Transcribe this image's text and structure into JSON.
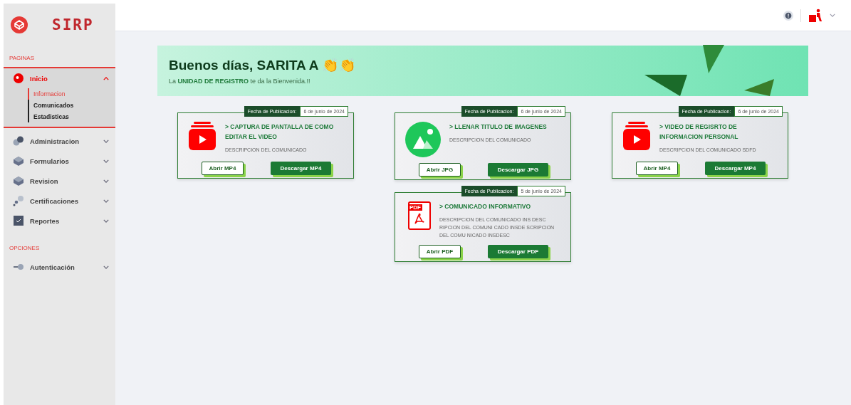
{
  "sidebar": {
    "brand": "SIRP",
    "sections": [
      {
        "title": "PAGINAS",
        "items": [
          {
            "label": "Inicio",
            "kind": "dot",
            "expanded": true,
            "selected": true,
            "children": [
              {
                "label": "Informacion",
                "selected": true
              },
              {
                "label": "Comunicados",
                "selected": false
              },
              {
                "label": "Estadisticas",
                "selected": false
              }
            ]
          },
          {
            "label": "Administracion",
            "kind": "blobs",
            "expanded": false,
            "selected": false
          },
          {
            "label": "Formularios",
            "kind": "cube",
            "expanded": false,
            "selected": false
          },
          {
            "label": "Revision",
            "kind": "cube",
            "expanded": false,
            "selected": false
          },
          {
            "label": "Certificaciones",
            "kind": "pin",
            "expanded": false,
            "selected": false
          },
          {
            "label": "Reportes",
            "kind": "check",
            "expanded": false,
            "selected": false
          }
        ]
      },
      {
        "title": "OPCIONES",
        "items": [
          {
            "label": "Autenticación",
            "kind": "login",
            "expanded": false,
            "selected": false
          }
        ]
      }
    ]
  },
  "banner": {
    "greeting": "Buenos días, SARITA A 👏👏",
    "subtitle": "La **UNIDAD DE REGISTRO** te da la Bienvenida.!!"
  },
  "cards": [
    {
      "kind": "video",
      "date_label": "Fecha de Publicacion:",
      "date": "6 de junio de 2024",
      "title": "> CAPTURA DE PANTALLA DE COMO EDITAR EL VIDEO",
      "description": "DESCRIPCION DEL COMUNICADO",
      "open": "Abrir MP4",
      "download": "Descargar MP4"
    },
    {
      "kind": "image",
      "date_label": "Fecha de Publicacion:",
      "date": "6 de junio de 2024",
      "title": "> LLENAR TITULO DE IMAGENES",
      "description": "DESCRIPCION DEL COMUNICADO",
      "open": "Abrir JPG",
      "download": "Descargar JPG"
    },
    {
      "kind": "video",
      "date_label": "Fecha de Publicacion:",
      "date": "6 de junio de 2024",
      "title": "> VIDEO DE REGISRTO DE INFORMACION PERSONAL",
      "description": "DESCRIPCION DEL COMUNICADO SDFD",
      "open": "Abrir MP4",
      "download": "Descargar MP4"
    },
    {
      "kind": "pdf",
      "icon_text": "PDF",
      "date_label": "Fecha de Publicacion:",
      "date": "5 de junio de 2024",
      "title": "> COMUNICADO INFORMATIVO",
      "description": "DESCRIPCION DEL COMUNICADO INS DESC RIPCION DEL COMUNI CADO INSDE SCRIPCION DEL COMU NICADO INSDESC",
      "open": "Abrir PDF",
      "download": "Descargar PDF"
    }
  ]
}
